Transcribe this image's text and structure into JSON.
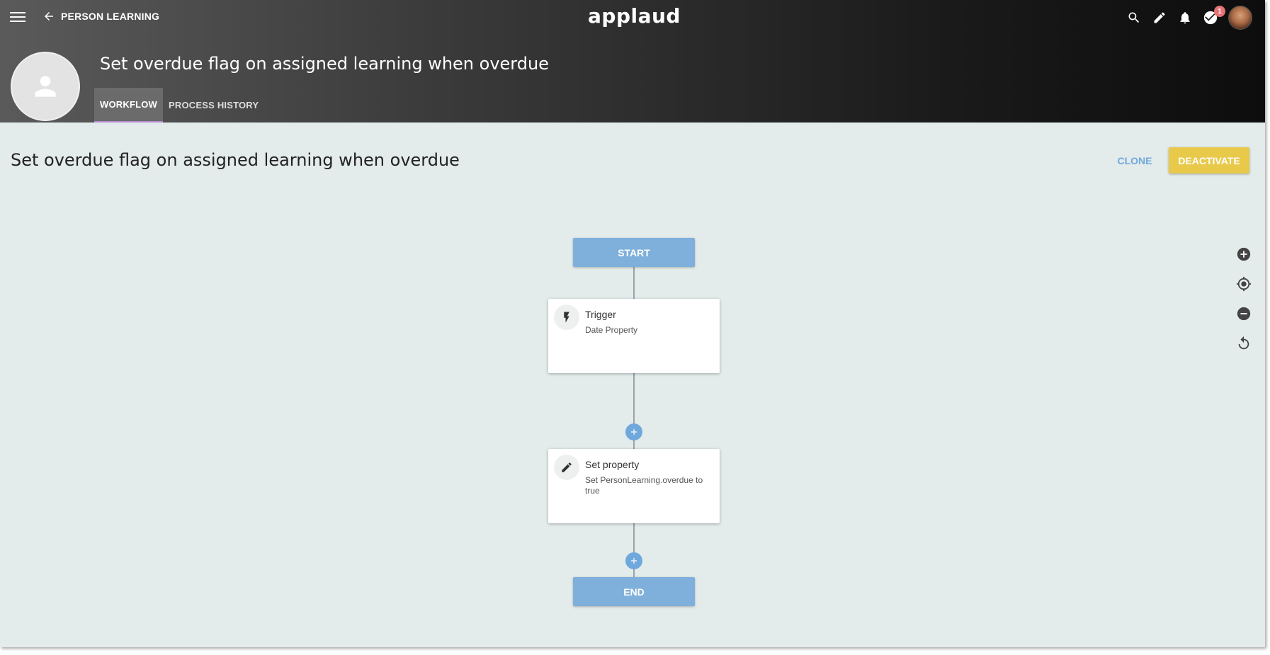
{
  "topbar": {
    "back_label": "PERSON LEARNING",
    "logo": "applaud",
    "notification_count": "1",
    "icons": [
      "menu-icon",
      "arrow-back-icon",
      "search-icon",
      "pencil-icon",
      "bell-icon",
      "check-circle-icon"
    ]
  },
  "header": {
    "title": "Set overdue flag on assigned learning when overdue",
    "tabs": [
      {
        "label": "WORKFLOW",
        "active": true
      },
      {
        "label": "PROCESS HISTORY",
        "active": false
      }
    ]
  },
  "main": {
    "title": "Set overdue flag on assigned learning when overdue",
    "clone_label": "CLONE",
    "deactivate_label": "DEACTIVATE"
  },
  "flow": {
    "start_label": "START",
    "end_label": "END",
    "nodes": [
      {
        "icon": "lightning-icon",
        "title": "Trigger",
        "subtitle": "Date Property"
      },
      {
        "icon": "pencil-icon",
        "title": "Set property",
        "subtitle": "Set PersonLearning.overdue to true"
      }
    ]
  },
  "zoom_controls": [
    "zoom-in-icon",
    "recenter-icon",
    "zoom-out-icon",
    "reset-icon"
  ],
  "colors": {
    "accent_blue": "#7fb0db",
    "deactivate_yellow": "#e8c94a",
    "canvas_bg": "#e3ebeb",
    "clone_blue": "#6fa8dc"
  }
}
